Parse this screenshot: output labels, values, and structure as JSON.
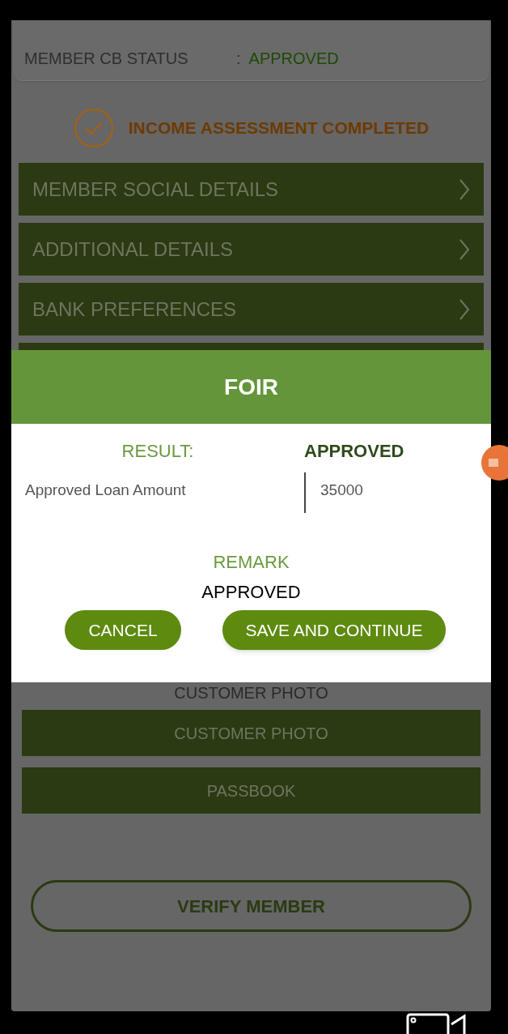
{
  "member_info": {
    "label": "MEMBER CB STATUS",
    "separator": ":",
    "value": "APPROVED"
  },
  "income_assessment": {
    "label": "INCOME ASSESSMENT COMPLETED",
    "completed": true
  },
  "sections": [
    {
      "label": "MEMBER SOCIAL DETAILS"
    },
    {
      "label": "ADDITIONAL DETAILS"
    },
    {
      "label": "BANK PREFERENCES"
    }
  ],
  "photos": {
    "heading": "CUSTOMER PHOTO",
    "buttons": [
      "CUSTOMER PHOTO",
      "PASSBOOK"
    ]
  },
  "verify_button": "VERIFY MEMBER",
  "dialog": {
    "title": "FOIR",
    "result_label": "RESULT:",
    "result_value": "APPROVED",
    "loan_label": "Approved Loan Amount",
    "loan_value": "35000",
    "remark_label": "REMARK",
    "remark_value": "APPROVED",
    "buttons": [
      {
        "label": "CANCEL",
        "kind": "secondary"
      },
      {
        "label": "SAVE AND CONTINUE",
        "kind": "primary"
      }
    ]
  }
}
